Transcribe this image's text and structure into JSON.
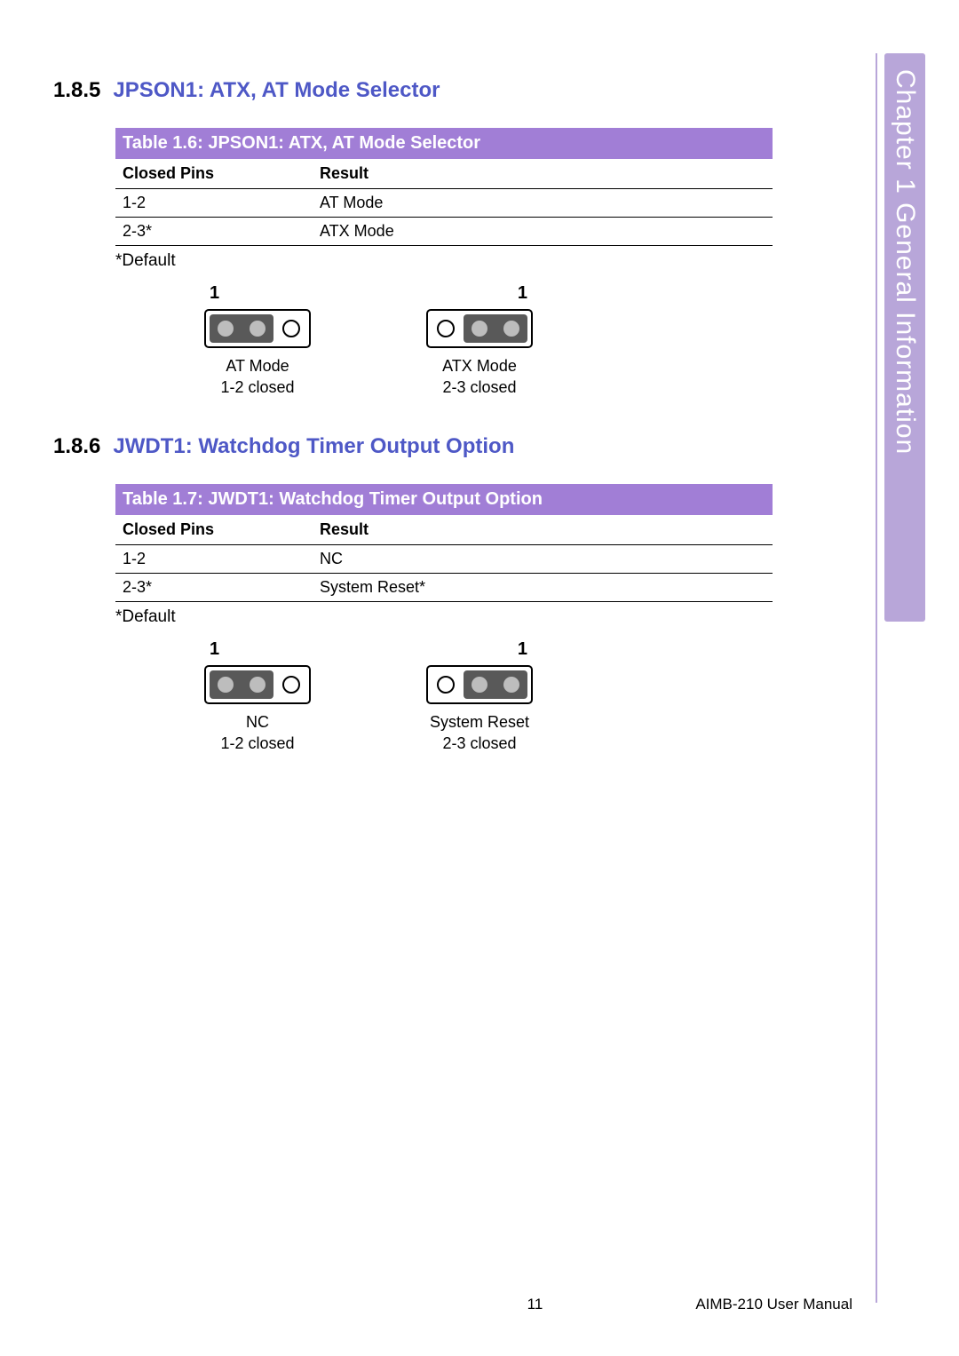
{
  "side_tab": "Chapter 1   General Information",
  "sections": {
    "s185": {
      "num": "1.8.5",
      "title": "JPSON1: ATX, AT Mode Selector",
      "table_title": "Table 1.6: JPSON1: ATX, AT Mode Selector",
      "head_col1": "Closed Pins",
      "head_col2": "Result",
      "rows": [
        {
          "pins": "1-2",
          "result": "AT Mode"
        },
        {
          "pins": "2-3*",
          "result": "ATX Mode"
        }
      ],
      "default_note": "*Default",
      "jumpers": {
        "left": {
          "pin1": "1",
          "caption_l1": "AT Mode",
          "caption_l2": "1-2 closed"
        },
        "right": {
          "pin1": "1",
          "caption_l1": "ATX Mode",
          "caption_l2": "2-3 closed"
        }
      }
    },
    "s186": {
      "num": "1.8.6",
      "title": "JWDT1: Watchdog Timer Output Option",
      "table_title": "Table 1.7: JWDT1: Watchdog Timer Output Option",
      "head_col1": "Closed Pins",
      "head_col2": "Result",
      "rows": [
        {
          "pins": "1-2",
          "result": "NC"
        },
        {
          "pins": "2-3*",
          "result": "System Reset*"
        }
      ],
      "default_note": "*Default",
      "jumpers": {
        "left": {
          "pin1": "1",
          "caption_l1": "NC",
          "caption_l2": "1-2 closed"
        },
        "right": {
          "pin1": "1",
          "caption_l1": "System Reset",
          "caption_l2": "2-3 closed"
        }
      }
    }
  },
  "footer": {
    "page_number": "11",
    "manual": "AIMB-210 User Manual"
  }
}
